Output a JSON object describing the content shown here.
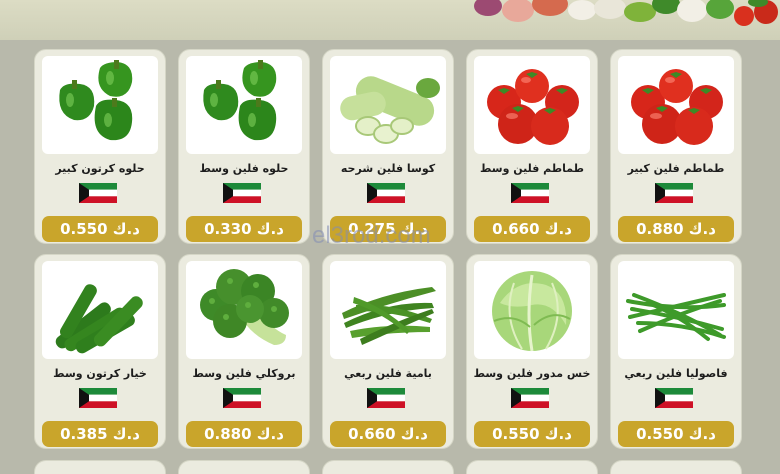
{
  "currency_flag": "kuwait-flag-icon",
  "colors": {
    "background": "#b8b9ab",
    "card": "#ebebdf",
    "price_badge": "#c9a52b",
    "price_text": "#ffffff"
  },
  "watermark": "el3rod.com",
  "rows": [
    [
      {
        "name": "طماطم فلين كبير",
        "price": "0.880 د.ك",
        "icon": "tomato-icon"
      },
      {
        "name": "طماطم فلين وسط",
        "price": "0.660 د.ك",
        "icon": "tomato-icon"
      },
      {
        "name": "كوسا فلين شرحه",
        "price": "0.275 د.ك",
        "icon": "zucchini-icon"
      },
      {
        "name": "حلوه فلين وسط",
        "price": "0.330 د.ك",
        "icon": "bell-pepper-icon"
      },
      {
        "name": "حلوه كرتون كبير",
        "price": "0.550 د.ك",
        "icon": "bell-pepper-icon"
      }
    ],
    [
      {
        "name": "فاصوليا فلين ربعي",
        "price": "0.550 د.ك",
        "icon": "green-beans-icon"
      },
      {
        "name": "خس مدور فلين وسط",
        "price": "0.550 د.ك",
        "icon": "lettuce-icon"
      },
      {
        "name": "بامية فلين ربعي",
        "price": "0.660 د.ك",
        "icon": "okra-icon"
      },
      {
        "name": "بروكلي فلين وسط",
        "price": "0.880 د.ك",
        "icon": "broccoli-icon"
      },
      {
        "name": "خيار كرتون وسط",
        "price": "0.385 د.ك",
        "icon": "cucumber-icon"
      }
    ]
  ]
}
